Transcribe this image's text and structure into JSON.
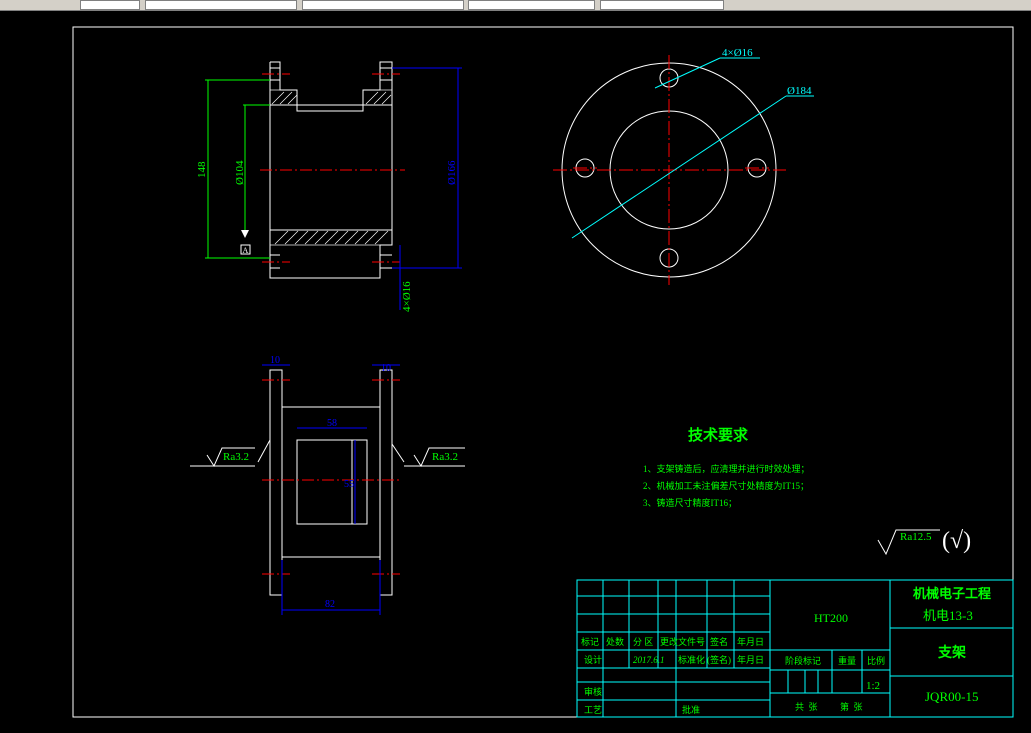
{
  "colors": {
    "background": "#000000",
    "line": "#ffffff",
    "dimension": "#00ff00",
    "dimension_blue": "#0000ff",
    "centerline": "#ff0000",
    "leader": "#00ffff",
    "title_text": "#00ff00",
    "table_lines": "#00ffff"
  },
  "front_view": {
    "dim_height": "148",
    "dim_inner_diameter": "Ø104",
    "dim_outer_diameter": "Ø166",
    "dim_holes": "4×Ø16",
    "datum": "A"
  },
  "side_view": {
    "dim_holes": "4×Ø16",
    "dim_flange": "Ø184"
  },
  "bottom_view": {
    "dim_left_flange": "10",
    "dim_right_flange": "10",
    "dim_window_width": "58",
    "dim_window_height": "55",
    "dim_overall_width": "82",
    "roughness_left": "Ra3.2",
    "roughness_right": "Ra3.2"
  },
  "tech_requirements": {
    "title": "技术要求",
    "items": [
      "1、支架铸造后，应清理并进行时效处理；",
      "2、机械加工未注偏差尺寸处精度为IT15；",
      "3、铸造尺寸精度IT16；"
    ]
  },
  "surface_finish": {
    "value": "Ra12.5",
    "symbol": "(√)"
  },
  "title_block": {
    "material": "HT200",
    "school": "机械电子工程",
    "class": "机电13-3",
    "part_name": "支架",
    "drawing_no": "JQR00-15",
    "scale_label": "比例",
    "scale": "1:2",
    "weight_label": "重量",
    "stage_label": "阶段标记",
    "sheet_total": "共  张",
    "sheet_no": "第  张",
    "headers": [
      "标记",
      "处数",
      "分 区",
      "更改文件号",
      "签名",
      "年月日"
    ],
    "design_label": "设计",
    "design_date": "2017.6.1",
    "standard_label": "标准化",
    "signature_label": "(签名)",
    "date_label": "年月日",
    "review_label": "审核",
    "process_label": "工艺",
    "approve_label": "批准"
  }
}
